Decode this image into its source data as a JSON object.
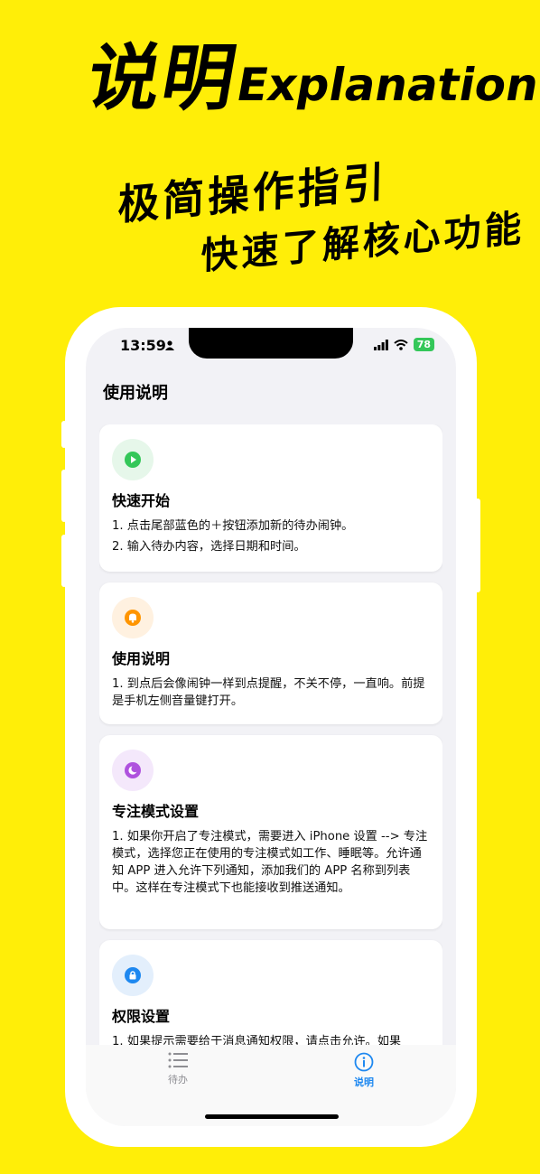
{
  "promo": {
    "headline_cn": "说明",
    "headline_en": "Explanation",
    "tagline_1": "极简操作指引",
    "tagline_2": "快速了解核心功能"
  },
  "status_bar": {
    "time": "13:59",
    "battery": "78"
  },
  "page_title": "使用说明",
  "cards": [
    {
      "icon": "play-icon",
      "color": "#34C759",
      "bg": "#E6F7EA",
      "title": "快速开始",
      "lines": [
        "1. 点击尾部蓝色的＋按钮添加新的待办闹钟。",
        "2. 输入待办内容，选择日期和时间。"
      ]
    },
    {
      "icon": "bell-icon",
      "color": "#FF9500",
      "bg": "#FFF1E0",
      "title": "使用说明",
      "lines": [
        "1. 到点后会像闹钟一样到点提醒，不关不停，一直响。前提是手机左侧音量键打开。"
      ]
    },
    {
      "icon": "moon-icon",
      "color": "#AF52DE",
      "bg": "#F4E8FB",
      "title": "专注模式设置",
      "lines": [
        "1. 如果你开启了专注模式，需要进入 iPhone 设置 --> 专注模式，选择您正在使用的专注模式如工作、睡眠等。允许通知 APP 进入允许下列通知，添加我们的 APP 名称到列表中。这样在专注模式下也能接收到推送通知。"
      ]
    },
    {
      "icon": "lock-icon",
      "color": "#1E88F0",
      "bg": "#E3EFFC",
      "title": "权限设置",
      "lines": [
        "1. 如果提示需要给于消息通知权限，请点击允许。如果"
      ]
    }
  ],
  "tabs": [
    {
      "label": "待办",
      "icon": "list-icon",
      "active": false
    },
    {
      "label": "说明",
      "icon": "info-icon",
      "active": true
    }
  ],
  "colors": {
    "background": "#FFEE08",
    "active_tab": "#1E88F0",
    "inactive_tab": "#8E8E93"
  }
}
